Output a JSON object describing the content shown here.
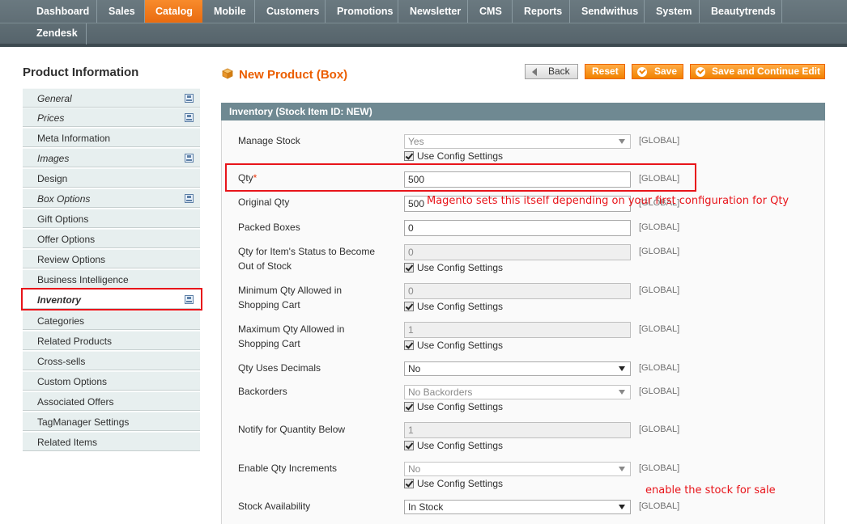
{
  "nav": {
    "items": [
      "Dashboard",
      "Sales",
      "Catalog",
      "Mobile",
      "Customers",
      "Promotions",
      "Newsletter",
      "CMS",
      "Reports",
      "Sendwithus",
      "System",
      "Beautytrends"
    ],
    "row2": [
      "Zendesk"
    ],
    "active": "Catalog"
  },
  "sidebar": {
    "title": "Product Information",
    "tabs": [
      {
        "label": "General"
      },
      {
        "label": "Prices"
      },
      {
        "label": "Meta Information"
      },
      {
        "label": "Images"
      },
      {
        "label": "Design"
      },
      {
        "label": "Box Options"
      },
      {
        "label": "Gift Options"
      },
      {
        "label": "Offer Options"
      },
      {
        "label": "Review Options"
      },
      {
        "label": "Business Intelligence"
      },
      {
        "label": "Inventory"
      },
      {
        "label": "Categories"
      },
      {
        "label": "Related Products"
      },
      {
        "label": "Cross-sells"
      },
      {
        "label": "Custom Options"
      },
      {
        "label": "Associated Offers"
      },
      {
        "label": "TagManager Settings"
      },
      {
        "label": "Related Items"
      }
    ]
  },
  "header": {
    "title": "New Product (Box)",
    "buttons": {
      "back": "Back",
      "reset": "Reset",
      "save": "Save",
      "save_continue": "Save and Continue Edit"
    }
  },
  "fieldset": {
    "title": "Inventory (Stock Item ID: NEW)",
    "scope": "[GLOBAL]",
    "config_label": "Use Config Settings",
    "fields": {
      "manage_stock": {
        "label": "Manage Stock",
        "value": "Yes"
      },
      "qty": {
        "label": "Qty",
        "required": "*",
        "value": "500"
      },
      "original_qty": {
        "label": "Original Qty",
        "value": "500"
      },
      "packed_boxes": {
        "label": "Packed Boxes",
        "value": "0"
      },
      "out_of_stock": {
        "label1": "Qty for Item's Status to Become",
        "label2": "Out of Stock",
        "value": "0"
      },
      "min_qty": {
        "label1": "Minimum Qty Allowed in",
        "label2": "Shopping Cart",
        "value": "0"
      },
      "max_qty": {
        "label1": "Maximum Qty Allowed in",
        "label2": "Shopping Cart",
        "value": "1"
      },
      "decimals": {
        "label": "Qty Uses Decimals",
        "value": "No"
      },
      "backorders": {
        "label": "Backorders",
        "value": "No Backorders"
      },
      "notify": {
        "label": "Notify for Quantity Below",
        "value": "1"
      },
      "increments": {
        "label": "Enable Qty Increments",
        "value": "No"
      },
      "availability": {
        "label": "Stock Availability",
        "value": "In Stock"
      }
    }
  },
  "annotations": {
    "qty_note": "Magento sets this itself depending on your first configuration for Qty",
    "stock_note": "enable the stock for sale",
    "highlight_color": "#e8141a"
  },
  "colors": {
    "accent": "#eb5e00",
    "nav_bg": "#5f6e75",
    "active_tab": "#f18200",
    "fieldset_head": "#6f8992"
  }
}
